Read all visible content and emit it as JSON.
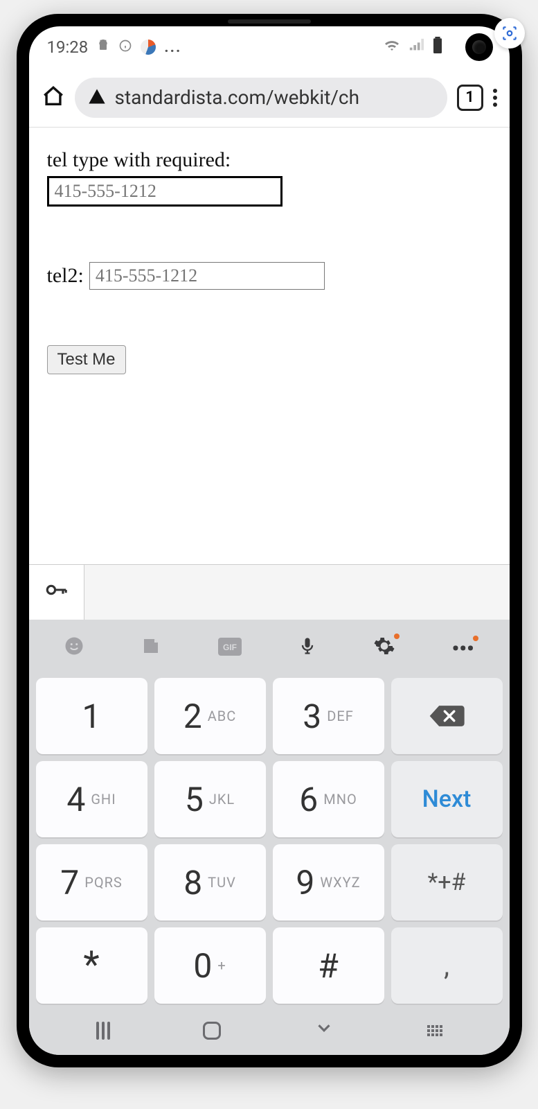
{
  "status": {
    "time": "19:28",
    "icons": {
      "android": "android-icon",
      "info": "info-icon",
      "swirl": "swirl-icon",
      "dots": "..."
    },
    "right": {
      "wifi": "wifi-icon",
      "signal": "signal-icon",
      "battery": "battery-icon"
    }
  },
  "browser": {
    "url_display": "standardista.com/webkit/ch",
    "tab_count": "1"
  },
  "page": {
    "field1_label": "tel type with required:",
    "field1_placeholder": "415-555-1212",
    "field2_label": "tel2:",
    "field2_placeholder": "415-555-1212",
    "submit_label": "Test Me"
  },
  "keyboard": {
    "toolbar": [
      "emoji",
      "sticker",
      "gif",
      "mic",
      "settings",
      "more"
    ],
    "keys": [
      {
        "d": "1",
        "l": ""
      },
      {
        "d": "2",
        "l": "ABC"
      },
      {
        "d": "3",
        "l": "DEF"
      },
      {
        "type": "backspace"
      },
      {
        "d": "4",
        "l": "GHI"
      },
      {
        "d": "5",
        "l": "JKL"
      },
      {
        "d": "6",
        "l": "MNO"
      },
      {
        "type": "next",
        "label": "Next"
      },
      {
        "d": "7",
        "l": "PQRS"
      },
      {
        "d": "8",
        "l": "TUV"
      },
      {
        "d": "9",
        "l": "WXYZ"
      },
      {
        "type": "sym",
        "label": "*+#"
      },
      {
        "type": "star",
        "label": "*"
      },
      {
        "d": "0",
        "l": "+"
      },
      {
        "type": "hash",
        "label": "#"
      },
      {
        "type": "comma",
        "label": ","
      }
    ]
  }
}
